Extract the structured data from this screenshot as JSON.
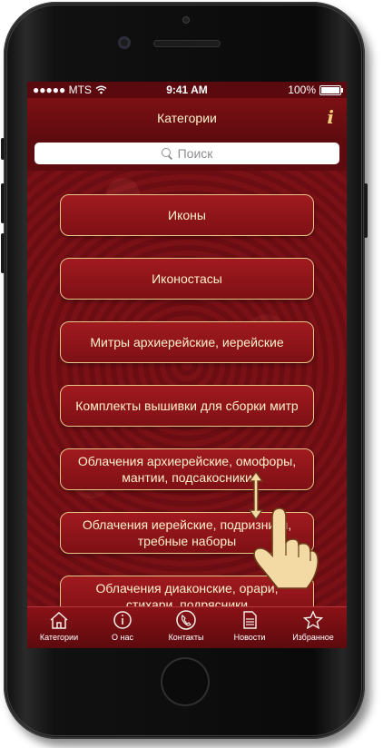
{
  "status_bar": {
    "carrier": "●●●●● MTS",
    "time": "9:41 AM",
    "battery": "100%"
  },
  "header": {
    "title": "Категории",
    "info_label": "i"
  },
  "search": {
    "placeholder": "Поиск"
  },
  "categories": [
    "Иконы",
    "Иконостасы",
    "Митры архиерейские, иерейские",
    "Комплекты вышивки для сборки митр",
    "Облачения архиерейские, омофоры, мантии, подсакосники",
    "Облачения иерейские, подризники, требные наборы",
    "Облачения диаконские, орари, стихари, подрясники"
  ],
  "tabs": [
    {
      "label": "Категории",
      "icon": "home-icon"
    },
    {
      "label": "О нас",
      "icon": "info-icon"
    },
    {
      "label": "Контакты",
      "icon": "phone-icon"
    },
    {
      "label": "Новости",
      "icon": "document-icon"
    },
    {
      "label": "Избранное",
      "icon": "star-icon"
    }
  ],
  "colors": {
    "accent": "#e9c78a",
    "primary": "#7e1015",
    "text": "#fff1cc"
  }
}
